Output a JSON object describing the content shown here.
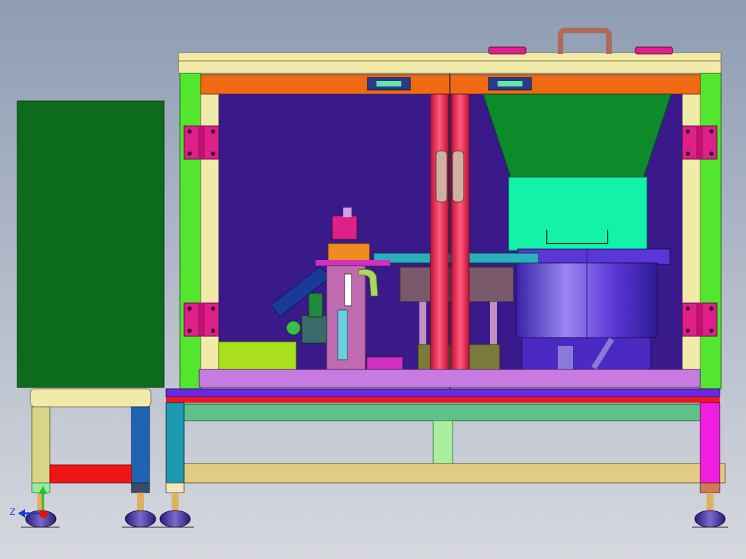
{
  "view": {
    "background_top": "#8e9cb4",
    "background_bottom": "#d6d8de"
  },
  "triad": {
    "axis_label": "Z",
    "x_color": "#1a3cc8",
    "y_color": "#22c42a",
    "origin_color": "#e01010"
  },
  "colors": {
    "cabinet_panel": "#0d6b1c",
    "frame_green": "#52e62e",
    "frame_cream": "#f2eaa8",
    "top_beam_orange": "#f06a14",
    "interior_purple": "#3a1a8a",
    "hinge_magenta": "#e0208a",
    "center_post_red": "#f02a52",
    "hopper_green": "#0d8a2a",
    "hopper_mint": "#12f2a8",
    "bowl_violet": "#5a36d6",
    "base_plate_lilac": "#c77ae0",
    "base_rail_blue": "#6a2ae0",
    "base_rail_red": "#f0141e",
    "cross_rail_green": "#5fc08a",
    "lower_rail_tan": "#e2cc84",
    "leg_cyan": "#1e9ab0",
    "leg_pink": "#f01ee0",
    "foot_indigo": "#3a2a8a",
    "handle_brown": "#b06a5a"
  }
}
